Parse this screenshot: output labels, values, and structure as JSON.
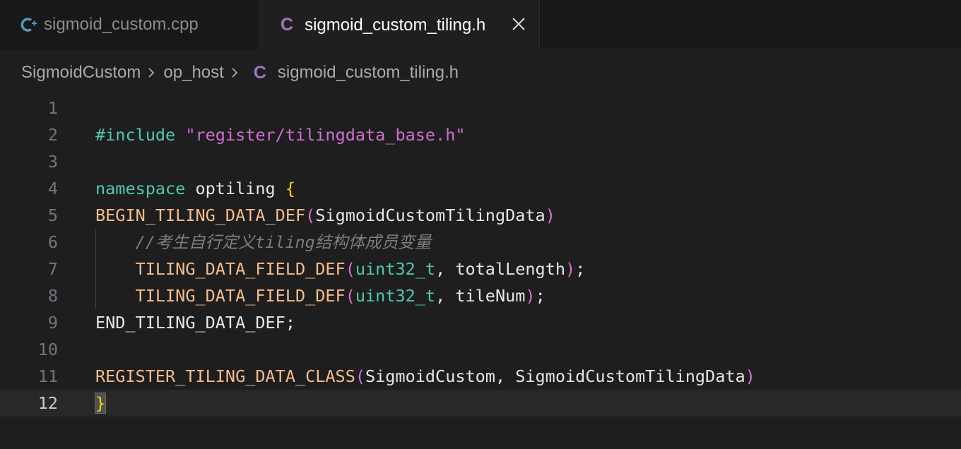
{
  "tabs": [
    {
      "label": "sigmoid_custom.cpp",
      "icon": "cpp-file-icon",
      "active": false
    },
    {
      "label": "sigmoid_custom_tiling.h",
      "icon": "c-file-icon",
      "active": true,
      "icon_glyph": "C",
      "close_glyph": "✕"
    }
  ],
  "breadcrumb": {
    "items": [
      "SigmoidCustom",
      "op_host"
    ],
    "file_icon_glyph": "C",
    "file": "sigmoid_custom_tiling.h"
  },
  "editor": {
    "current_line": 12,
    "lines": [
      {
        "n": "1",
        "tokens": []
      },
      {
        "n": "2",
        "tokens": [
          [
            "#include ",
            "green"
          ],
          [
            "\"register/tilingdata_base.h\"",
            "str"
          ]
        ]
      },
      {
        "n": "3",
        "tokens": []
      },
      {
        "n": "4",
        "tokens": [
          [
            "namespace",
            "green"
          ],
          [
            " optiling ",
            "white"
          ],
          [
            "{",
            "yellow"
          ]
        ]
      },
      {
        "n": "5",
        "tokens": [
          [
            "BEGIN_TILING_DATA_DEF",
            "orange"
          ],
          [
            "(",
            "pink"
          ],
          [
            "SigmoidCustomTilingData",
            "white"
          ],
          [
            ")",
            "pink"
          ]
        ]
      },
      {
        "n": "6",
        "tokens": [
          [
            "    ",
            "white"
          ],
          [
            "//考生自行定义tiling结构体成员变量",
            "comment"
          ]
        ]
      },
      {
        "n": "7",
        "tokens": [
          [
            "    ",
            "white"
          ],
          [
            "TILING_DATA_FIELD_DEF",
            "orange"
          ],
          [
            "(",
            "pink"
          ],
          [
            "uint32_t",
            "type"
          ],
          [
            ", totalLength",
            "white"
          ],
          [
            ")",
            "pink"
          ],
          [
            ";",
            "white"
          ]
        ]
      },
      {
        "n": "8",
        "tokens": [
          [
            "    ",
            "white"
          ],
          [
            "TILING_DATA_FIELD_DEF",
            "orange"
          ],
          [
            "(",
            "pink"
          ],
          [
            "uint32_t",
            "type"
          ],
          [
            ", tileNum",
            "white"
          ],
          [
            ")",
            "pink"
          ],
          [
            ";",
            "white"
          ]
        ]
      },
      {
        "n": "9",
        "tokens": [
          [
            "END_TILING_DATA_DEF;",
            "white"
          ]
        ]
      },
      {
        "n": "10",
        "tokens": []
      },
      {
        "n": "11",
        "tokens": [
          [
            "REGISTER_TILING_DATA_CLASS",
            "orange"
          ],
          [
            "(",
            "pink"
          ],
          [
            "SigmoidCustom, SigmoidCustomTilingData",
            "white"
          ],
          [
            ")",
            "pink"
          ]
        ]
      },
      {
        "n": "12",
        "tokens": [
          [
            "}",
            "yellow",
            "cursor"
          ]
        ]
      }
    ]
  },
  "colors": {
    "background": "#1e1e1e",
    "keyword": "#4ec9b0",
    "string": "#ce6fd0",
    "macro": "#f4bd8c",
    "brace": "#ffd700",
    "paren": "#da70d6",
    "comment": "#7d7d7d"
  }
}
